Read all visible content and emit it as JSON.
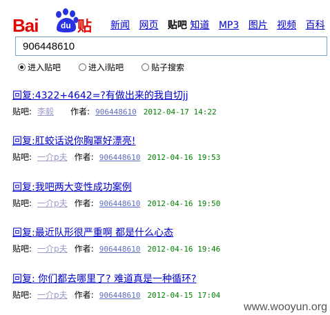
{
  "logo": {
    "bai": "Bai",
    "du": "du",
    "tieba": "贴吧"
  },
  "nav": {
    "items": [
      {
        "label": "新闻",
        "current": false
      },
      {
        "label": "网页",
        "current": false
      },
      {
        "label": "贴吧",
        "current": true
      },
      {
        "label": "知道",
        "current": false
      },
      {
        "label": "MP3",
        "current": false
      },
      {
        "label": "图片",
        "current": false
      },
      {
        "label": "视频",
        "current": false
      },
      {
        "label": "百科",
        "current": false
      }
    ]
  },
  "search": {
    "value": "906448610"
  },
  "radios": [
    {
      "label": "进入贴吧",
      "checked": true
    },
    {
      "label": "进入i贴吧",
      "checked": false
    },
    {
      "label": "贴子搜索",
      "checked": false
    }
  ],
  "results": [
    {
      "title": "回复:4322+4642=?有做出来的我自切jj",
      "bar_label": "贴吧:",
      "author": "李毅",
      "author_label": "作者:",
      "uid": "906448610",
      "time": "2012-04-17 14:22"
    },
    {
      "title": "回复:肛蛟话说你胸罩好漂亮!",
      "bar_label": "贴吧:",
      "author": "一介p夫",
      "author_label": "作者:",
      "uid": "906448610",
      "time": "2012-04-16 19:53"
    },
    {
      "title": "回复:我吧两大变性成功案例",
      "bar_label": "贴吧:",
      "author": "一介p夫",
      "author_label": "作者:",
      "uid": "906448610",
      "time": "2012-04-16 19:50"
    },
    {
      "title": "回复:最近队形很严重啊 都是什么心态",
      "bar_label": "贴吧:",
      "author": "一介p夫",
      "author_label": "作者:",
      "uid": "906448610",
      "time": "2012-04-16 19:46"
    },
    {
      "title": "回复: 你们都去哪里了? 难道真是一种循环?",
      "bar_label": "贴吧:",
      "author": "一介p夫",
      "author_label": "作者:",
      "uid": "906448610",
      "time": "2012-04-15 17:04"
    }
  ],
  "watermark": "www.wooyun.org",
  "colors": {
    "brand_red": "#e10602",
    "paw_blue": "#2932e1",
    "link": "#0000cc",
    "time_green": "#008000"
  }
}
